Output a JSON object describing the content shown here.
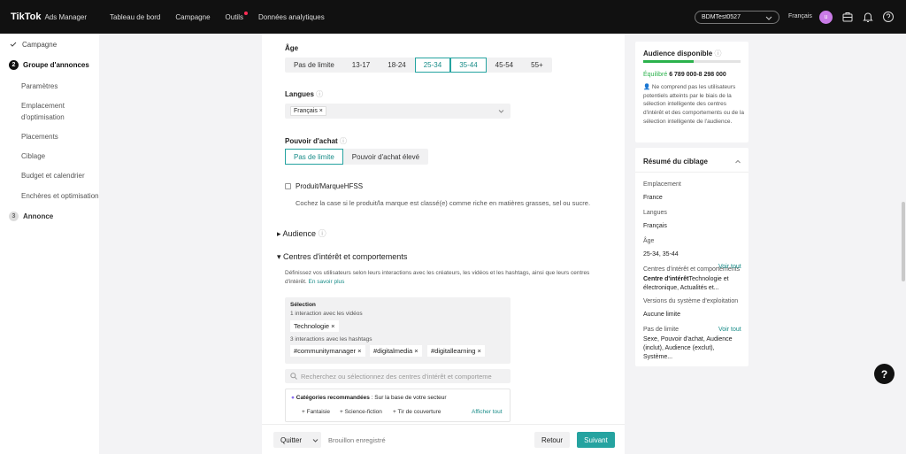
{
  "header": {
    "logo": "TikTok",
    "subtitle": "Ads Manager",
    "nav": [
      "Tableau de bord",
      "Campagne",
      "Outils",
      "Données analytiques"
    ],
    "account": "BDMTest0527",
    "language": "Français",
    "avatar_letter": "u"
  },
  "sidebar": {
    "campaign": "Campagne",
    "step2_num": "2",
    "ad_group": "Groupe d'annonces",
    "subs": [
      "Paramètres",
      "Emplacement d'optimisation",
      "Placements",
      "Ciblage",
      "Budget et calendrier",
      "Enchères et optimisation"
    ],
    "step3_num": "3",
    "ad": "Annonce"
  },
  "age": {
    "title": "Âge",
    "options": [
      "Pas de limite",
      "13-17",
      "18-24",
      "25-34",
      "35-44",
      "45-54",
      "55+"
    ]
  },
  "langues": {
    "title": "Langues",
    "chip": "Français ×"
  },
  "purchase": {
    "title": "Pouvoir d'achat",
    "opt1": "Pas de limite",
    "opt2": "Pouvoir d'achat élevé"
  },
  "hfss": {
    "label": "Produit/MarqueHFSS",
    "desc": "Cochez la case si le produit/la marque est classé(e) comme riche en matières grasses, sel ou sucre."
  },
  "audience_section": "Audience",
  "interests": {
    "title": "Centres d'intérêt et comportements",
    "desc": "Définissez vos utilisateurs selon leurs interactions avec les créateurs, les vidéos et les hashtags, ainsi que leurs centres d'intérêt.",
    "learn_more": "En savoir plus",
    "selection": "Sélection",
    "video_label": "1 interaction avec les vidéos",
    "video_tag": "Technologie ×",
    "hashtag_label": "3 interactions avec les hashtags",
    "hashtags": [
      "#communitymanager ×",
      "#digitalmedia ×",
      "#digitallearning ×"
    ],
    "search_placeholder": "Recherchez ou sélectionnez des centres d'intérêt et comporteme",
    "reco_title": "Catégories recommandées",
    "reco_sub": " : Sur la base de votre secteur",
    "reco_items": [
      "+ Fantaisie",
      "+ Science-fiction",
      "+ Tir de couverture"
    ],
    "show_all": "Afficher tout"
  },
  "footer": {
    "quit": "Quitter",
    "draft": "Brouillon enregistré",
    "back": "Retour",
    "next": "Suivant"
  },
  "audience_card": {
    "title": "Audience disponible",
    "status": "Équilibré",
    "range": "6 789 000-8 298 000",
    "fill_percent": 52,
    "note": "Ne comprend pas les utilisateurs potentiels atteints par le biais de la sélection intelligente des centres d'intérêt et des comportements ou de la sélection intelligente de l'audience."
  },
  "summary": {
    "title": "Résumé du ciblage",
    "placement_label": "Emplacement",
    "placement": "France",
    "lang_label": "Langues",
    "lang": "Français",
    "age_label": "Âge",
    "age": "25-34, 35-44",
    "interest_label": "Centres d'intérêt et comportements",
    "see_all": "Voir tout",
    "interest_value_bold": "Centre d'intérêt",
    "interest_value": "Technologie et électronique, Actualités et...",
    "os_label": "Versions du système d'exploitation",
    "os": "Aucune limite",
    "nolimit_label": "Pas de limite",
    "nolimit": "Sexe, Pouvoir d'achat, Audience (inclut), Audience (exclut), Système..."
  },
  "colors": {
    "accent": "#25a3a0",
    "topbar": "#111111",
    "progress": "#2bb24c"
  }
}
